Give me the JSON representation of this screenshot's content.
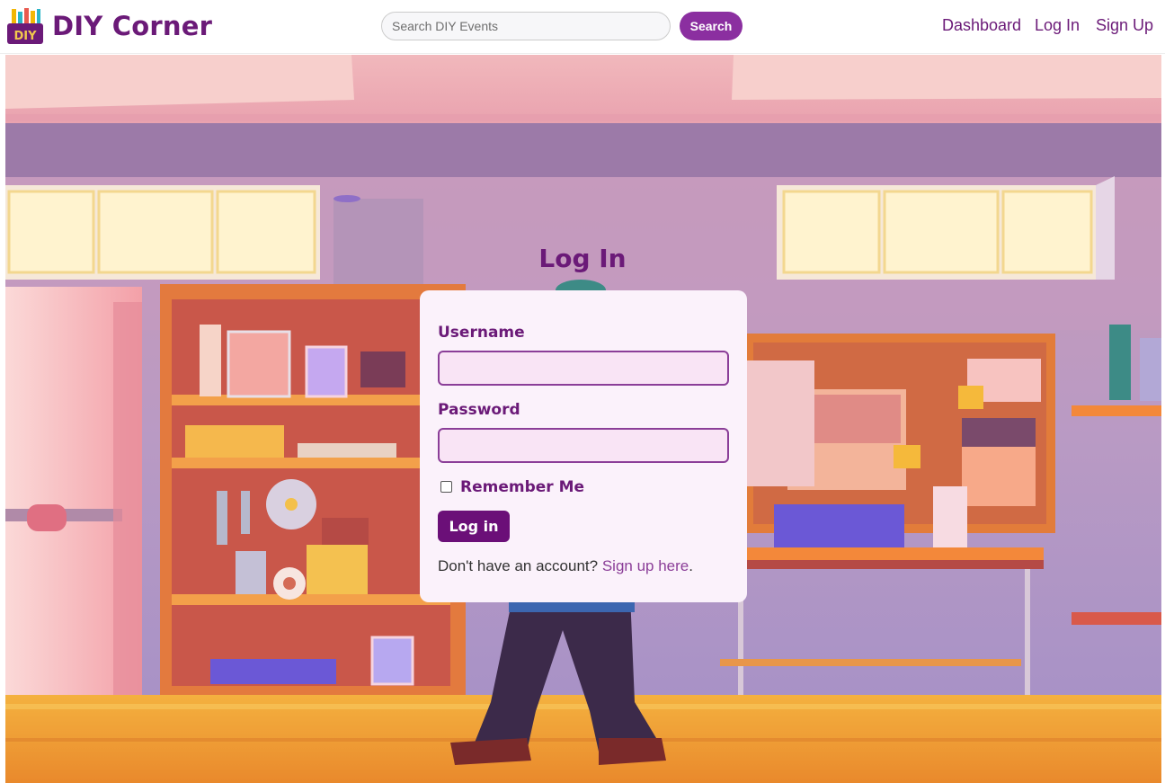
{
  "header": {
    "brand": "DIY Corner",
    "logo_icon": "toolbox-logo-icon",
    "logo_text": "DIY",
    "search": {
      "placeholder": "Search DIY Events",
      "value": "",
      "button_label": "Search"
    },
    "nav": {
      "dashboard": "Dashboard",
      "login": "Log In",
      "signup": "Sign Up"
    }
  },
  "login": {
    "title": "Log In",
    "username_label": "Username",
    "username_value": "",
    "password_label": "Password",
    "password_value": "",
    "remember_label": "Remember Me",
    "remember_checked": false,
    "submit_label": "Log in",
    "signup_prompt": "Don't have an account?",
    "signup_link": "Sign up here",
    "signup_suffix": "."
  },
  "colors": {
    "brand": "#6b1a78",
    "button": "#8b2fa0",
    "submit": "#6b0f78",
    "card": "#fbf2fb",
    "field_bg": "#f9e4f5"
  },
  "background_illustration": "workshop-garage-illustration"
}
